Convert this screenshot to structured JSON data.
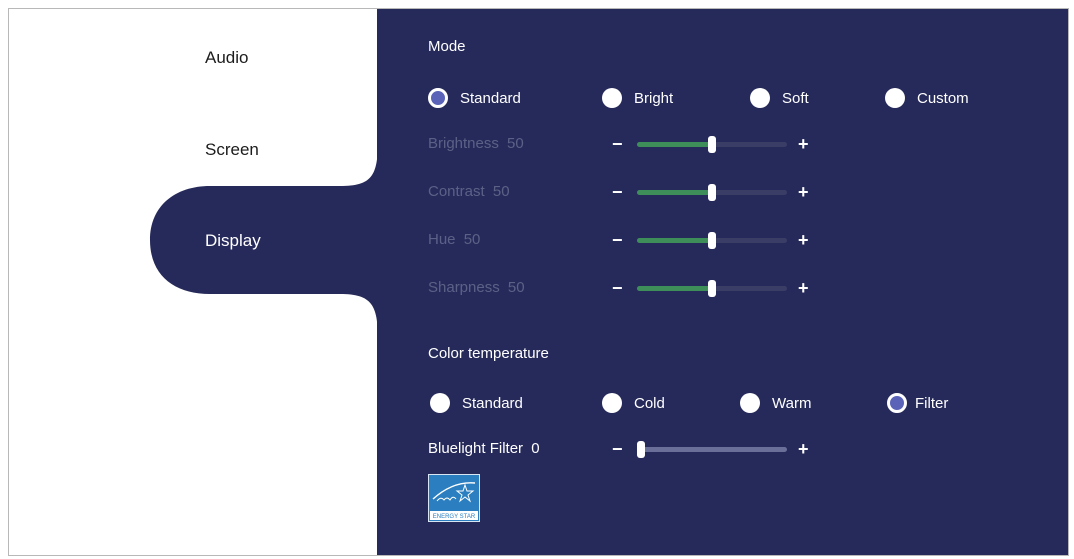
{
  "sidebar": {
    "items": [
      {
        "label": "Audio"
      },
      {
        "label": "Screen"
      },
      {
        "label": "Display"
      }
    ]
  },
  "mode": {
    "title": "Mode",
    "options": [
      "Standard",
      "Bright",
      "Soft",
      "Custom"
    ],
    "selected": "Standard"
  },
  "sliders": [
    {
      "label": "Brightness",
      "value": "50",
      "level": 50
    },
    {
      "label": "Contrast",
      "value": "50",
      "level": 50
    },
    {
      "label": "Hue",
      "value": "50",
      "level": 50
    },
    {
      "label": "Sharpness",
      "value": "50",
      "level": 50
    }
  ],
  "color_temperature": {
    "title": "Color temperature",
    "options": [
      "Standard",
      "Cold",
      "Warm",
      "Filter"
    ],
    "selected": "Filter"
  },
  "bluelight": {
    "label": "Bluelight Filter",
    "value": "0",
    "level": 0
  },
  "controls": {
    "minus": "−",
    "plus": "+"
  },
  "energy_star": {
    "text": "ENERGY STAR"
  },
  "colors": {
    "panel": "#262a5a",
    "slider_fill": "#3e8e5a",
    "radio_selected": "#5a63b8"
  }
}
